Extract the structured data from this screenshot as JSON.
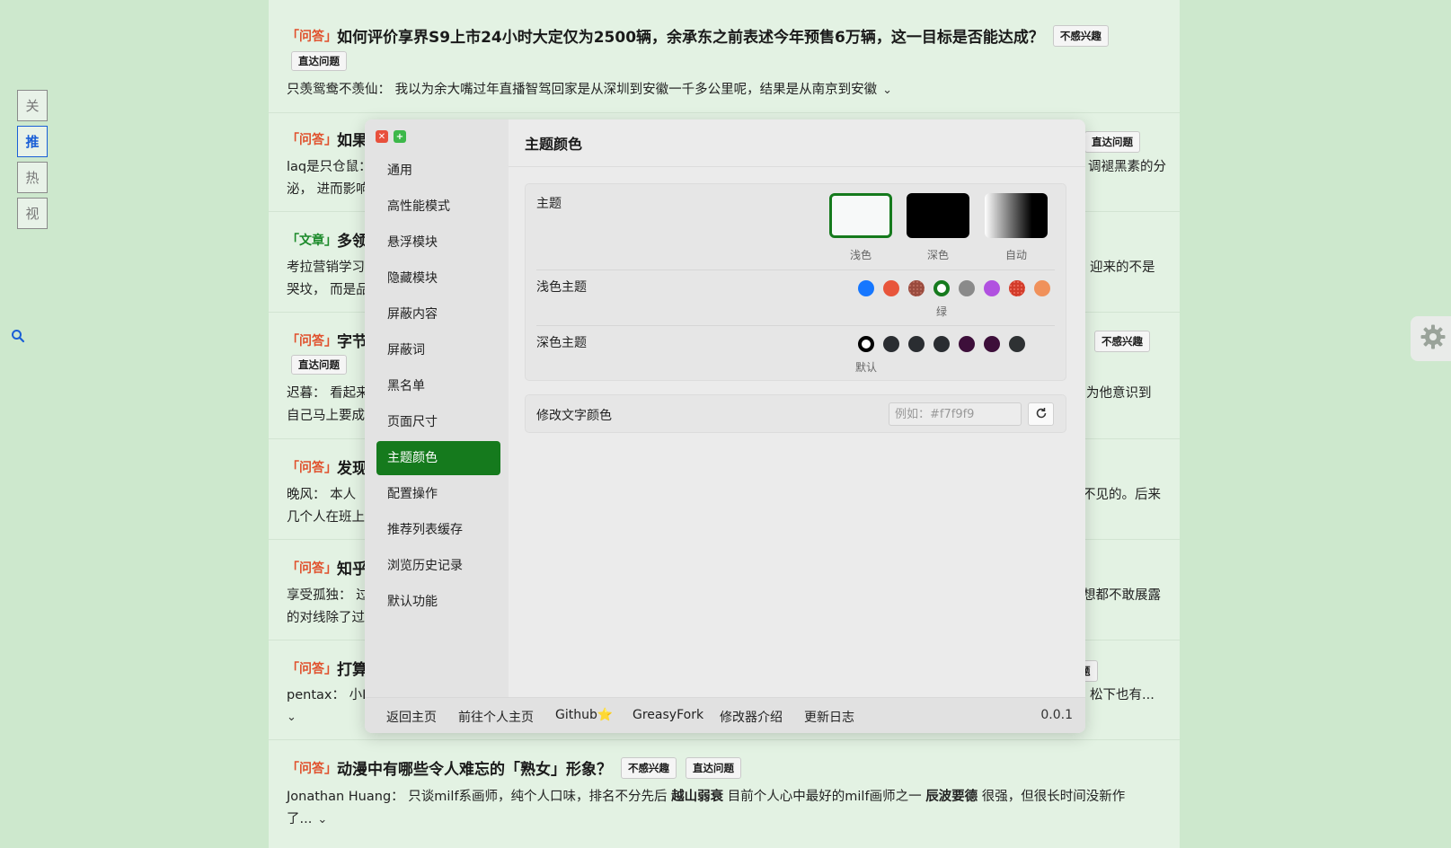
{
  "side_tabs": [
    {
      "label": "关",
      "active": false
    },
    {
      "label": "推",
      "active": true
    },
    {
      "label": "热",
      "active": false
    },
    {
      "label": "视",
      "active": false
    }
  ],
  "feed": [
    {
      "tag": "「问答」",
      "title": "如何评价享界S9上市24小时大定仅为2500辆，余承东之前表述今年预售6万辆，这一目标是否能达成？",
      "pill_a": "不感兴趣",
      "pill_b": "直达问题",
      "excerpt": "只羡鸳鸯不羡仙：  我以为余大嘴过年直播智驾回家是从深圳到安徽一千多公里呢，结果是从南京到安徽"
    },
    {
      "tag": "「问答」",
      "title_frag": "如果",
      "pill_b": "直达问题",
      "excerpt_l1": "laq是只仓鼠：",
      "excerpt_l1_right": "调褪黑素的分",
      "excerpt_l2": "泌，  进而影响"
    },
    {
      "tag": "「文章」",
      "title_frag": "多领",
      "excerpt_l1": "考拉营销学习",
      "excerpt_l1_right": "迎来的不是",
      "excerpt_l2": "哭坟，  而是品"
    },
    {
      "tag": "「问答」",
      "title_frag": "字节",
      "pill_a": "不感兴趣",
      "pill_b": "直达问题",
      "excerpt_l1": "迟暮：  看起来",
      "excerpt_l1_right": "为他意识到",
      "excerpt_l2": "自己马上要成"
    },
    {
      "tag": "「问答」",
      "title_frag": "发现",
      "excerpt_l1": "晚风：  本人",
      "excerpt_l1_right": "不见的。后来",
      "excerpt_l2": "几个人在班上"
    },
    {
      "tag": "「问答」",
      "title_frag": "知乎",
      "excerpt_l1": "享受孤独：  过",
      "excerpt_l1_right": "想都不敢展露",
      "excerpt_l2": "的对线除了过"
    },
    {
      "tag": "「问答」",
      "title_frag": "打算",
      "pill_frag": "题",
      "excerpt_l1": "pentax：  小ID",
      "excerpt_l1_right": "松下也有..."
    },
    {
      "tag": "「问答」",
      "title": "动漫中有哪些令人难忘的「熟女」形象？",
      "pill_a": "不感兴趣",
      "pill_b": "直达问题",
      "excerpt_l1": "Jonathan Huang：  只谈milf系画师，纯个人口味，排名不分先后 ",
      "excerpt_bold1": "越山弱衰",
      "excerpt_mid": " 目前个人心中最好的milf画师之一 ",
      "excerpt_bold2": "辰波要德",
      "excerpt_tail": " 很强，但很长时间没新作",
      "excerpt_l2": "了..."
    }
  ],
  "modal": {
    "menu": [
      "通用",
      "高性能模式",
      "悬浮模块",
      "隐藏模块",
      "屏蔽内容",
      "屏蔽词",
      "黑名单",
      "页面尺寸",
      "主题颜色",
      "配置操作",
      "推荐列表缓存",
      "浏览历史记录",
      "默认功能"
    ],
    "active_menu": "主题颜色",
    "header": "主题颜色",
    "theme_label": "主题",
    "themes": [
      {
        "caption": "浅色",
        "color": "#f7f9f9",
        "selected": true
      },
      {
        "caption": "深色",
        "color": "#000000",
        "selected": false
      },
      {
        "caption": "自动",
        "color": "gradient",
        "selected": false
      }
    ],
    "light_label": "浅色主题",
    "light_colors": [
      "#1677ff",
      "#e8553b",
      "#9a4b3e",
      "#157a1d",
      "#8a8a8a",
      "#b151e0",
      "#d23b2a",
      "#f0915b"
    ],
    "light_selected_caption": "绿",
    "dark_label": "深色主题",
    "dark_colors": [
      "#000000",
      "#2a2d31",
      "#2a2d31",
      "#2a2d31",
      "#3d0f3a",
      "#3d0f3a",
      "#2e3133"
    ],
    "dark_selected_caption": "默认",
    "text_color_label": "修改文字颜色",
    "text_color_placeholder": "例如：#f7f9f9",
    "footer_links": [
      "返回主页",
      "前往个人主页",
      "Github⭐",
      "GreasyFork",
      "修改器介绍",
      "更新日志"
    ],
    "version": "0.0.1"
  },
  "colors": {
    "page_bg": "#cde8cd",
    "feed_bg": "#e3f2e3",
    "accent_green": "#157a1d",
    "tag_red": "#e0502c"
  }
}
